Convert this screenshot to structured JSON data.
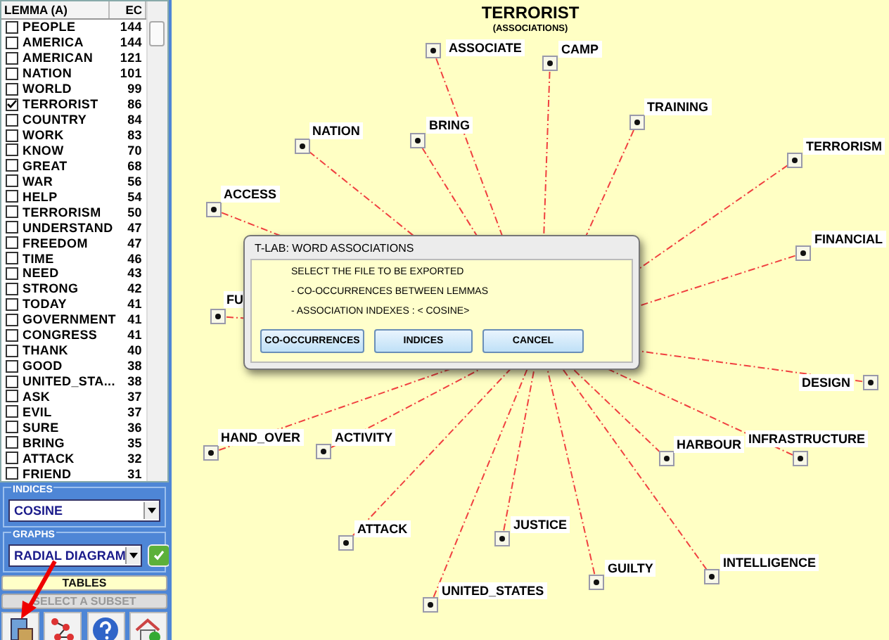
{
  "lemma_list": {
    "columns": [
      "LEMMA (A)",
      "EC"
    ],
    "rows": [
      {
        "lemma": "PEOPLE",
        "ec": "144",
        "checked": false
      },
      {
        "lemma": "AMERICA",
        "ec": "144",
        "checked": false
      },
      {
        "lemma": "AMERICAN",
        "ec": "121",
        "checked": false
      },
      {
        "lemma": "NATION",
        "ec": "101",
        "checked": false
      },
      {
        "lemma": "WORLD",
        "ec": "99",
        "checked": false
      },
      {
        "lemma": "TERRORIST",
        "ec": "86",
        "checked": true
      },
      {
        "lemma": "COUNTRY",
        "ec": "84",
        "checked": false
      },
      {
        "lemma": "WORK",
        "ec": "83",
        "checked": false
      },
      {
        "lemma": "KNOW",
        "ec": "70",
        "checked": false
      },
      {
        "lemma": "GREAT",
        "ec": "68",
        "checked": false
      },
      {
        "lemma": "WAR",
        "ec": "56",
        "checked": false
      },
      {
        "lemma": "HELP",
        "ec": "54",
        "checked": false
      },
      {
        "lemma": "TERRORISM",
        "ec": "50",
        "checked": false
      },
      {
        "lemma": "UNDERSTAND",
        "ec": "47",
        "checked": false
      },
      {
        "lemma": "FREEDOM",
        "ec": "47",
        "checked": false
      },
      {
        "lemma": "TIME",
        "ec": "46",
        "checked": false
      },
      {
        "lemma": "NEED",
        "ec": "43",
        "checked": false
      },
      {
        "lemma": "STRONG",
        "ec": "42",
        "checked": false
      },
      {
        "lemma": "TODAY",
        "ec": "41",
        "checked": false
      },
      {
        "lemma": "GOVERNMENT",
        "ec": "41",
        "checked": false
      },
      {
        "lemma": "CONGRESS",
        "ec": "41",
        "checked": false
      },
      {
        "lemma": "THANK",
        "ec": "40",
        "checked": false
      },
      {
        "lemma": "GOOD",
        "ec": "38",
        "checked": false
      },
      {
        "lemma": "UNITED_STA...",
        "ec": "38",
        "checked": false
      },
      {
        "lemma": "ASK",
        "ec": "37",
        "checked": false
      },
      {
        "lemma": "EVIL",
        "ec": "37",
        "checked": false
      },
      {
        "lemma": "SURE",
        "ec": "36",
        "checked": false
      },
      {
        "lemma": "BRING",
        "ec": "35",
        "checked": false
      },
      {
        "lemma": "ATTACK",
        "ec": "32",
        "checked": false
      },
      {
        "lemma": "FRIEND",
        "ec": "31",
        "checked": false
      }
    ]
  },
  "indices": {
    "label": "INDICES",
    "value": "COSINE"
  },
  "graphs": {
    "label": "GRAPHS",
    "value": "RADIAL DIAGRAM"
  },
  "buttons": [
    {
      "label": "TABLES",
      "disabled": false
    },
    {
      "label": "SELECT A SUBSET",
      "disabled": true
    }
  ],
  "diagram": {
    "title": "TERRORIST",
    "subtitle": "(ASSOCIATIONS)",
    "nodes": [
      "ASSOCIATE",
      "CAMP",
      "TRAINING",
      "NATION",
      "BRING",
      "TERRORISM",
      "ACCESS",
      "FINANCIAL",
      "FU",
      "DESIGN",
      "HAND_OVER",
      "ACTIVITY",
      "HARBOUR",
      "INFRASTRUCTURE",
      "ATTACK",
      "JUSTICE",
      "GUILTY",
      "INTELLIGENCE",
      "UNITED_STATES"
    ]
  },
  "dialog": {
    "title": "T-LAB: WORD ASSOCIATIONS",
    "lines": [
      "SELECT THE FILE TO BE EXPORTED",
      "- CO-OCCURRENCES BETWEEN LEMMAS",
      "- ASSOCIATION INDEXES : < COSINE>"
    ],
    "buttons": [
      "CO-OCCURRENCES",
      "INDICES",
      "CANCEL"
    ]
  }
}
